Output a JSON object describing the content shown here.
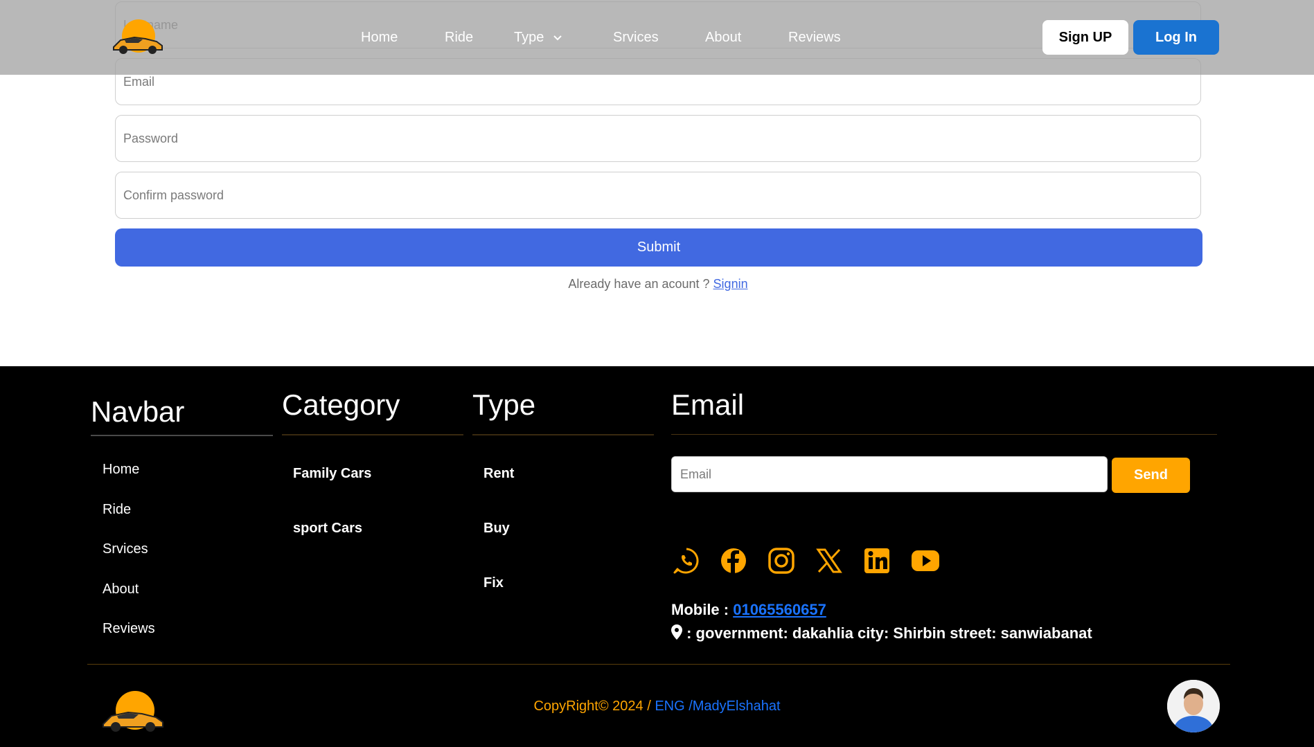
{
  "form": {
    "lastname_placeholder": "Lastname",
    "email_placeholder": "Email",
    "password_placeholder": "Password",
    "confirm_placeholder": "Confirm password",
    "submit_label": "Submit",
    "have_account_text": "Already have an acount ? ",
    "signin_link": "Signin"
  },
  "header": {
    "nav": [
      "Home",
      "Ride",
      "Type",
      "Srvices",
      "About",
      "Reviews"
    ],
    "signup_label": "Sign UP",
    "login_label": "Log In"
  },
  "footer": {
    "navbar_title": "Navbar",
    "navbar_items": [
      "Home",
      "Ride",
      "Srvices",
      "About",
      "Reviews"
    ],
    "category_title": "Category",
    "category_items": [
      "Family Cars",
      "sport Cars"
    ],
    "type_title": "Type",
    "type_items": [
      "Rent",
      "Buy",
      "Fix"
    ],
    "email_title": "Email",
    "email_placeholder": "Email",
    "send_label": "Send",
    "social_icons": [
      "whatsapp-icon",
      "facebook-icon",
      "instagram-icon",
      "x-icon",
      "linkedin-icon",
      "youtube-icon"
    ],
    "mobile_label": "Mobile : ",
    "mobile_number": "01065560657",
    "address": " : government: dakahlia city: Shirbin street: sanwiabanat",
    "copyright": "CopyRight© 2024 / ",
    "author": "ENG /MadyElshahat"
  },
  "colors": {
    "accent": "#ffa500",
    "submit": "#4169e1",
    "login": "#1a73d1",
    "link": "#1a73ff"
  }
}
